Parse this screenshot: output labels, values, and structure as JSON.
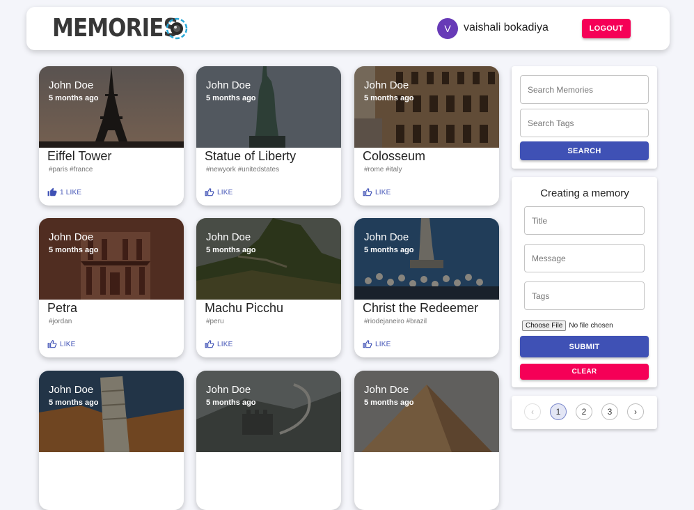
{
  "header": {
    "brand": "MEMORIES",
    "user_initial": "V",
    "user_name": "vaishali bokadiya",
    "logout_label": "LOGOUT"
  },
  "posts": [
    {
      "author": "John Doe",
      "time": "5 months ago",
      "title": "Eiffel Tower",
      "tags": "#paris #france",
      "like": "1 LIKE"
    },
    {
      "author": "John Doe",
      "time": "5 months ago",
      "title": "Statue of Liberty",
      "tags": "#newyork #unitedstates",
      "like": "LIKE"
    },
    {
      "author": "John Doe",
      "time": "5 months ago",
      "title": "Colosseum",
      "tags": "#rome #italy",
      "like": "LIKE"
    },
    {
      "author": "John Doe",
      "time": "5 months ago",
      "title": "Petra",
      "tags": "#jordan",
      "like": "LIKE"
    },
    {
      "author": "John Doe",
      "time": "5 months ago",
      "title": "Machu Picchu",
      "tags": "#peru",
      "like": "LIKE"
    },
    {
      "author": "John Doe",
      "time": "5 months ago",
      "title": "Christ the Redeemer",
      "tags": "#riodejaneiro #brazil",
      "like": "LIKE"
    },
    {
      "author": "John Doe",
      "time": "5 months ago"
    },
    {
      "author": "John Doe",
      "time": "5 months ago"
    },
    {
      "author": "John Doe",
      "time": "5 months ago"
    }
  ],
  "search": {
    "memories_placeholder": "Search Memories",
    "tags_placeholder": "Search Tags",
    "button_label": "SEARCH"
  },
  "form": {
    "title": "Creating a memory",
    "title_placeholder": "Title",
    "message_placeholder": "Message",
    "tags_placeholder": "Tags",
    "choose_file_label": "Choose File",
    "no_file_text": "No file chosen",
    "submit_label": "SUBMIT",
    "clear_label": "CLEAR"
  },
  "pagination": {
    "prev_icon": "‹",
    "pages": [
      "1",
      "2",
      "3"
    ],
    "current_page": "1",
    "next_icon": "›"
  },
  "colors": {
    "primary": "#3f51b5",
    "secondary": "#f50057",
    "avatar": "#673ab7"
  }
}
